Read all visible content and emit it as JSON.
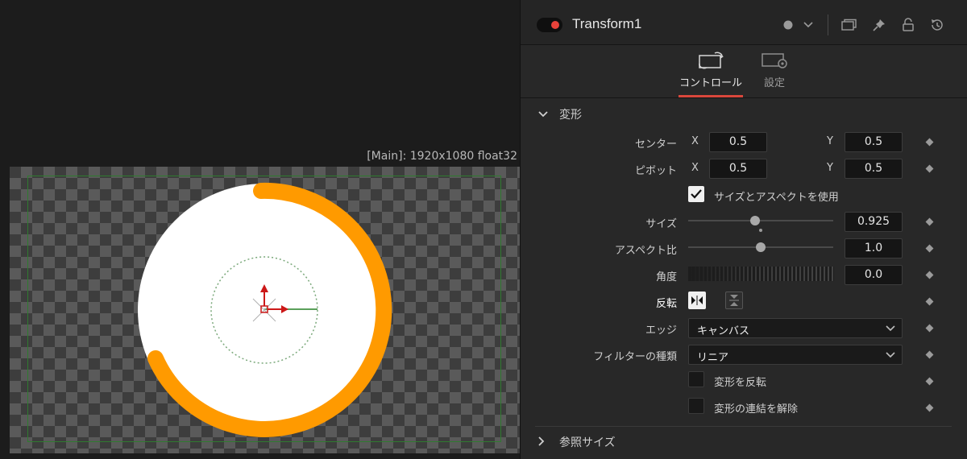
{
  "viewer": {
    "resolution_label": "[Main]: 1920x1080 float32"
  },
  "inspector": {
    "node_title": "Transform1",
    "tabs": [
      {
        "label": "コントロール",
        "icon": "transform-tab-icon",
        "active": true
      },
      {
        "label": "設定",
        "icon": "settings-tab-icon",
        "active": false
      }
    ],
    "section_transform": "変形",
    "section_reference_size": "参照サイズ",
    "center": {
      "label": "センター",
      "x_axis": "X",
      "x_value": "0.5",
      "y_axis": "Y",
      "y_value": "0.5"
    },
    "pivot": {
      "label": "ピボット",
      "x_axis": "X",
      "x_value": "0.5",
      "y_axis": "Y",
      "y_value": "0.5"
    },
    "use_size_aspect": {
      "label": "サイズとアスペクトを使用",
      "checked": true
    },
    "size": {
      "label": "サイズ",
      "value": "0.925",
      "slider_fraction": 0.46
    },
    "aspect": {
      "label": "アスペクト比",
      "value": "1.0",
      "slider_fraction": 0.5
    },
    "angle": {
      "label": "角度",
      "value": "0.0"
    },
    "flip": {
      "label": "反転",
      "horizontal_on": true,
      "vertical_on": false
    },
    "edges": {
      "label": "エッジ",
      "value": "キャンバス"
    },
    "filter": {
      "label": "フィルターの種類",
      "value": "リニア"
    },
    "invert_transform": {
      "label": "変形を反転",
      "checked": false
    },
    "flatten_transform": {
      "label": "変形の連結を解除",
      "checked": false
    }
  },
  "colors": {
    "accent_red": "#d9473c",
    "ring_orange": "#ff9a00",
    "safe_frame_green": "#2f7a2f"
  }
}
